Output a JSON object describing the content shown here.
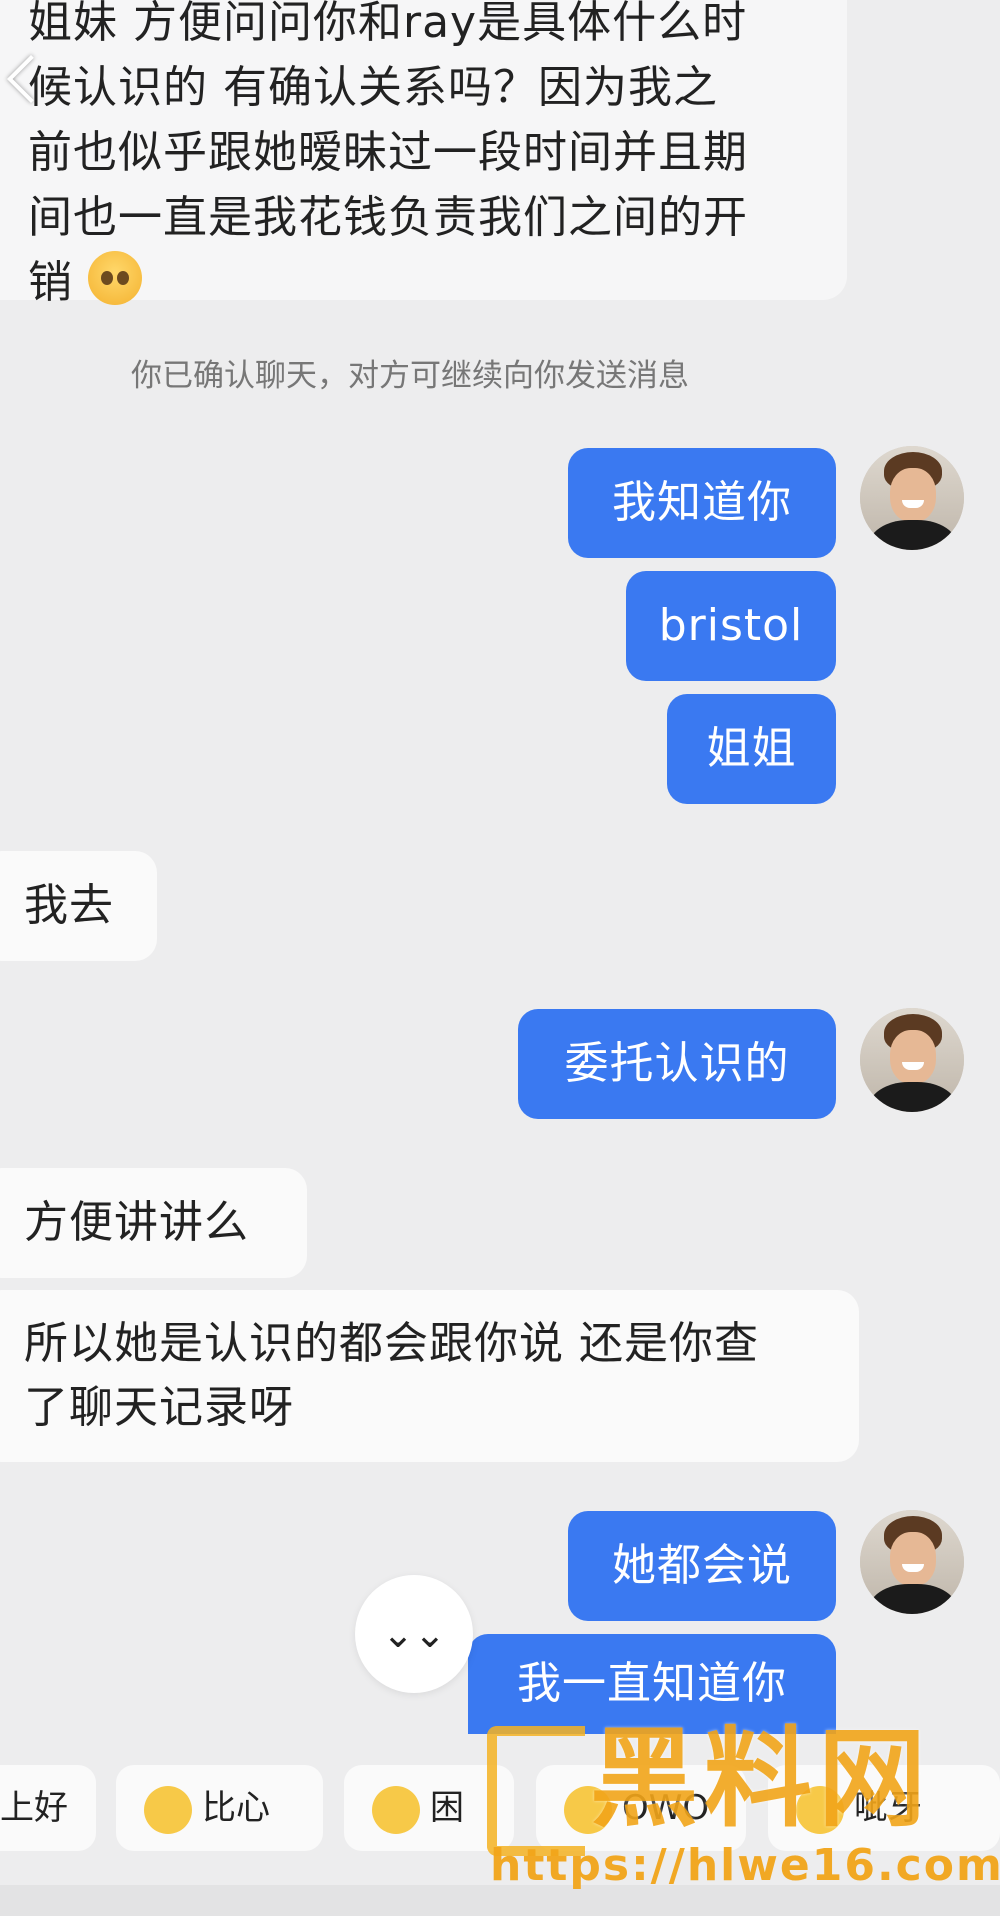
{
  "top_message": {
    "line1": "姐妹 方便问问你和ray是具体什么时",
    "line2": "候认识的 有确认关系吗？因为我之",
    "line3": "前也似乎跟她暧昧过一段时间并且期",
    "line4": "间也一直是我花钱负责我们之间的开",
    "line5": "销"
  },
  "system_note": "你已确认聊天，对方可继续向你发送消息",
  "messages": {
    "out1": "我知道你",
    "out2": "bristol",
    "out3": "姐姐",
    "in1": "我去",
    "out4": "委托认识的",
    "in2": "方便讲讲么",
    "in3_line1": "所以她是认识的都会跟你说 还是你查",
    "in3_line2": "了聊天记录呀",
    "out5": "她都会说",
    "out6": "我一直知道你"
  },
  "scroll_icon": "⌄⌄",
  "quick_replies": [
    {
      "label": "上好"
    },
    {
      "label": "比心"
    },
    {
      "label": "困"
    },
    {
      "label": "OWO"
    },
    {
      "label": "呲牙"
    }
  ],
  "watermark": {
    "title": "黑料网",
    "url": "https://hlwe16.com"
  },
  "colors": {
    "outgoing_bubble": "#3a79f1",
    "incoming_bubble": "#fafafa",
    "background": "#ededee",
    "watermark": "#f2a51a"
  },
  "icons": [
    "back-chevron-icon",
    "crying-emoji-icon",
    "scroll-down-icon",
    "user-avatar"
  ]
}
